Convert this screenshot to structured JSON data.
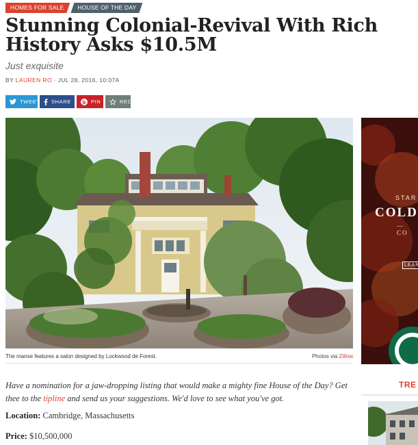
{
  "tags": {
    "primary": "Homes for sale",
    "secondary": "House of the Day"
  },
  "article": {
    "headline": "Stunning Colonial-Revival With Rich History Asks $10.5M",
    "dek": "Just exquisite",
    "byline_prefix": "By",
    "author": "Lauren Ro",
    "separator": "·",
    "date": "Jul 28, 2016, 10:07a"
  },
  "share": {
    "tweet": "Tweet",
    "share": "Share",
    "pin": "Pin",
    "rec": "Rec"
  },
  "photo": {
    "caption": "The manse features a salon designed by Lockwood de Forest.",
    "credit_prefix": "Photos via",
    "credit_link": "Zillow"
  },
  "intro": {
    "before_link": "Have a nomination for a jaw-dropping listing that would make a mighty fine House of the Day? Get thee to the",
    "link": "tipline",
    "after_link": "and send us your suggestions. We'd love to see what you've got."
  },
  "details": {
    "location_label": "Location:",
    "location_value": "Cambridge, Massachusetts",
    "price_label": "Price:",
    "price_value": "$10,500,000"
  },
  "ad": {
    "line1": "STAR",
    "line2": "COLD",
    "line3": "— CO",
    "line4": "LEAR"
  },
  "sidebar": {
    "trending_label": "TRE"
  },
  "colors": {
    "accent": "#d9432f",
    "twitter": "#2b97d4",
    "facebook": "#2d4d8d",
    "pinterest": "#c92228",
    "rec": "#6e7f7a"
  }
}
